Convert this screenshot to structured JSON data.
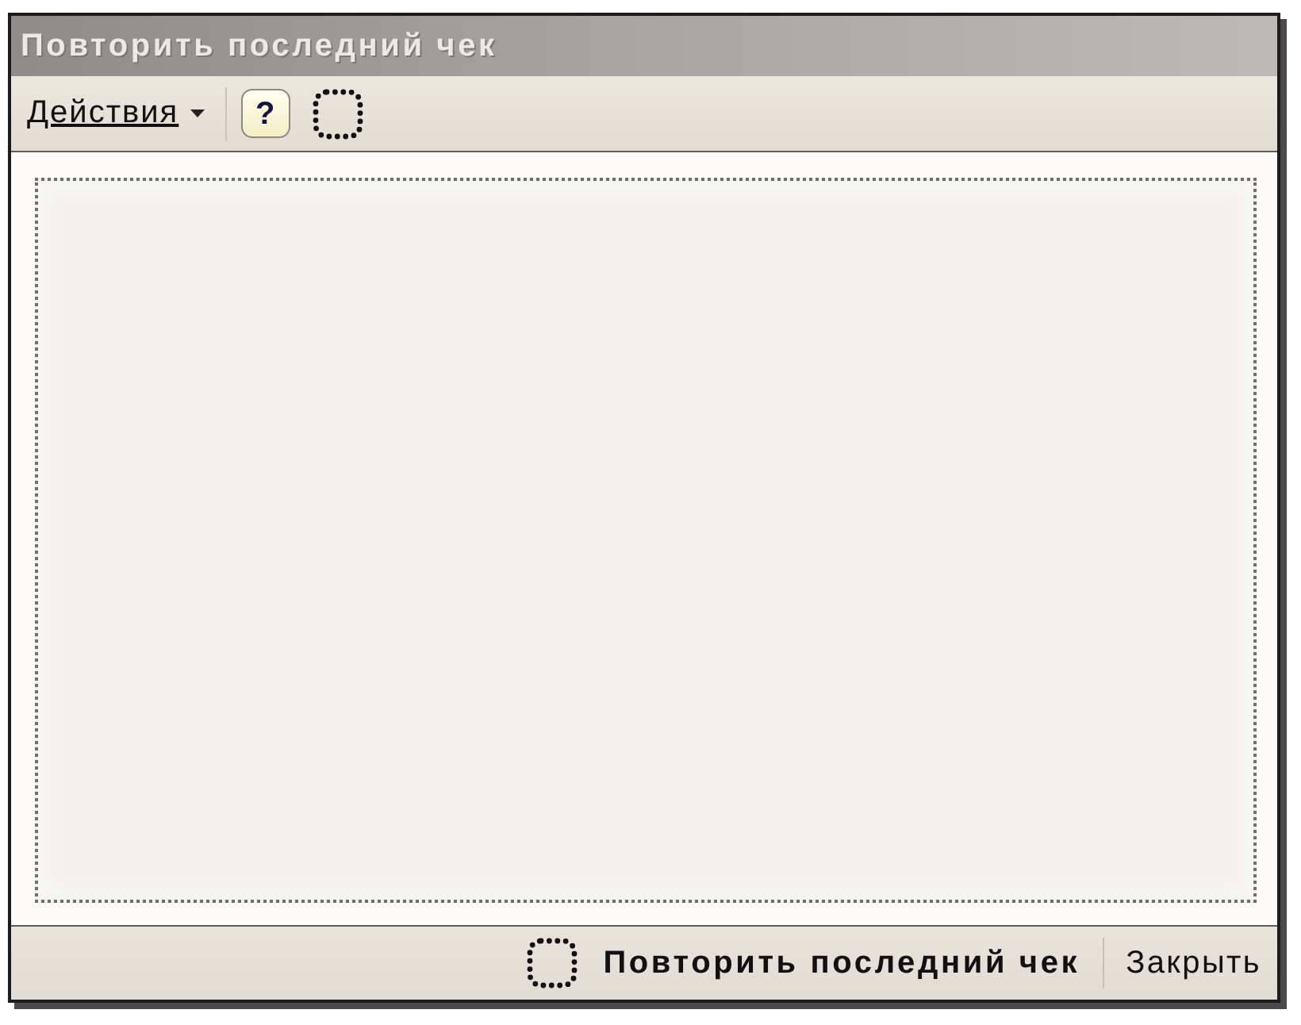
{
  "window": {
    "title": "Повторить последний чек"
  },
  "toolbar": {
    "actions_menu": "Действия",
    "help_button": "?"
  },
  "footer": {
    "buttons": [
      {
        "label": "Повторить последний чек",
        "kind": "default"
      },
      {
        "label": "Закрыть",
        "kind": "plain"
      }
    ]
  }
}
